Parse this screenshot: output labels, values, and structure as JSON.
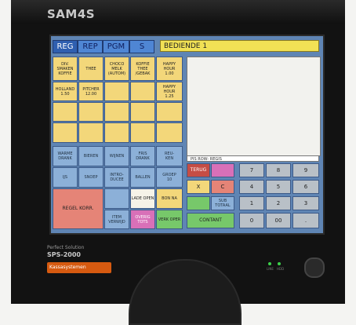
{
  "device": {
    "brand": "SAM4S",
    "model_small": "Perfect Solution",
    "model": "SPS-2000",
    "sticker": "Kassasystemen"
  },
  "tabs": [
    "REG",
    "REP",
    "PGM",
    "S"
  ],
  "operator": "BEDIENDE 1",
  "info_bar": "PIS          ROW- REGIS",
  "plu_row1": [
    [
      "DIV.",
      "SMAKEN",
      "KOFFIE"
    ],
    [
      "THEE"
    ],
    [
      "CHOCO",
      "MELK",
      "(AUTOM)"
    ],
    [
      "KOFFIE",
      "THEE",
      "/GEBAK"
    ],
    [
      "HAPPY",
      "HOUR",
      "1.00"
    ]
  ],
  "plu_row2": [
    [
      "HOLLAND",
      "1.50"
    ],
    [
      "PITCHER",
      "12.00"
    ],
    [
      ""
    ],
    [
      ""
    ],
    [
      "HAPPY",
      "HOUR",
      "1.25"
    ]
  ],
  "cat_row1": [
    [
      "WARME",
      "DRANK"
    ],
    [
      "BIEREN"
    ],
    [
      "WIJNEN"
    ],
    [
      "FRIS",
      "DRANK"
    ],
    [
      "REU-",
      "KEN"
    ]
  ],
  "cat_row2": [
    [
      "IJS"
    ],
    [
      "SNOEP"
    ],
    [
      "INTRO-",
      "DUCEE"
    ],
    [
      "BALLEN"
    ],
    [
      "GROEP",
      "10"
    ]
  ],
  "keys": {
    "regel_korr": "REGEL KORR.",
    "lade_open": "LADE OPEN",
    "bon_na": "BON NA",
    "item_void": "ITEM VERWIJD",
    "overig_totaal": "OVERIG TOTS",
    "verk_oper": "VERK OPER",
    "terug": "TERUG",
    "x": "X",
    "c": "C",
    "subtotaal": "SUB TOTAAL",
    "contant": "CONTANT",
    "d7": "7",
    "d8": "8",
    "d9": "9",
    "d4": "4",
    "d5": "5",
    "d6": "6",
    "d1": "1",
    "d2": "2",
    "d3": "3",
    "d0": "0",
    "d00": "00",
    "dot": "."
  },
  "status_leds": [
    "LINE",
    "HDD"
  ]
}
